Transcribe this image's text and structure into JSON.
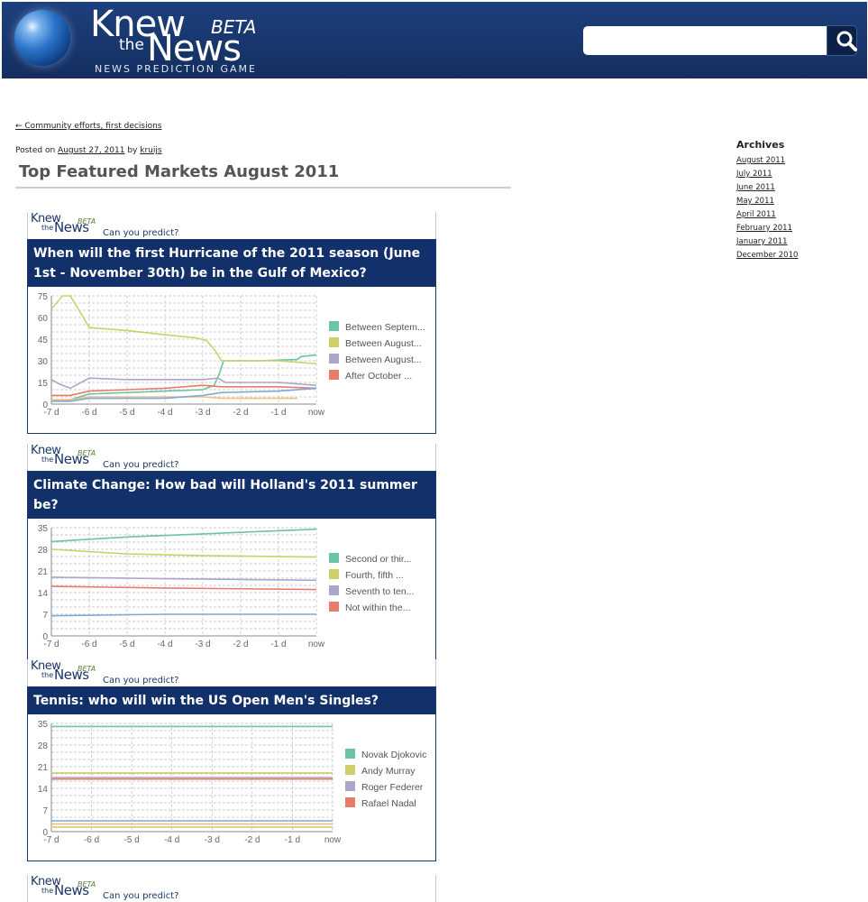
{
  "site": {
    "logo_knew": "Knew",
    "logo_the": "the",
    "logo_news": "News",
    "logo_beta": "BETA",
    "tagline": "NEWS PREDICTION GAME"
  },
  "search": {
    "placeholder": ""
  },
  "post": {
    "prev_link": "← Community efforts, first decisions",
    "posted_on_label": "Posted on",
    "date": "August 27, 2011",
    "by_label": "by",
    "author": "kruijs",
    "title": "Top Featured Markets August 2011"
  },
  "sidebar": {
    "archives_heading": "Archives",
    "archives": [
      "August 2011",
      "July 2011",
      "June 2011",
      "May 2011",
      "April 2011",
      "February 2011",
      "January 2011",
      "December 2010"
    ]
  },
  "widget_brand": {
    "knew": "Knew",
    "the": "the",
    "news": "News",
    "beta": "BETA",
    "can_you_predict": "Can you predict?"
  },
  "widgets": [
    {
      "question": "When will the first Hurricane of the 2011 season (June 1st - November 30th) be in the Gulf of Mexico?"
    },
    {
      "question": "Climate Change: How bad will Holland's 2011 summer be?"
    },
    {
      "question": "Tennis: who will win the US Open Men's Singles?"
    }
  ],
  "chart_data": [
    {
      "type": "line",
      "x_ticks": [
        "-7 d",
        "-6 d",
        "-5 d",
        "-4 d",
        "-3 d",
        "-2 d",
        "-1 d",
        "now"
      ],
      "y_ticks": [
        0,
        15,
        30,
        45,
        60,
        75
      ],
      "ylim": [
        0,
        75
      ],
      "xlim": [
        -7,
        0
      ],
      "grid": true,
      "legend_position": "right",
      "series": [
        {
          "name": "Between Septem...",
          "color": "#6cc4a4",
          "points": [
            [
              -7,
              3
            ],
            [
              -6.5,
              3
            ],
            [
              -6,
              7
            ],
            [
              -5,
              8
            ],
            [
              -4,
              9
            ],
            [
              -3,
              10
            ],
            [
              -2.7,
              13
            ],
            [
              -2.55,
              22
            ],
            [
              -2.45,
              30
            ],
            [
              -1.5,
              30
            ],
            [
              -0.5,
              31
            ],
            [
              -0.4,
              33
            ],
            [
              0,
              34
            ]
          ]
        },
        {
          "name": "Between August...",
          "color": "#cfcf6a",
          "points": [
            [
              -7,
              66
            ],
            [
              -6.7,
              75
            ],
            [
              -6.5,
              75
            ],
            [
              -6.2,
              62
            ],
            [
              -6,
              53
            ],
            [
              -5,
              51
            ],
            [
              -4,
              48
            ],
            [
              -3.2,
              46
            ],
            [
              -2.9,
              44
            ],
            [
              -2.7,
              38
            ],
            [
              -2.55,
              32
            ],
            [
              -2.5,
              30
            ],
            [
              -1,
              30
            ],
            [
              0,
              28
            ]
          ]
        },
        {
          "name": "Between August...",
          "color": "#aaa6cc",
          "points": [
            [
              -7,
              17
            ],
            [
              -6.8,
              14
            ],
            [
              -6.5,
              11
            ],
            [
              -6,
              18
            ],
            [
              -5,
              17
            ],
            [
              -4,
              17
            ],
            [
              -3,
              17
            ],
            [
              -2.6,
              18
            ],
            [
              -2.4,
              15
            ],
            [
              -1,
              15
            ],
            [
              0,
              13
            ]
          ]
        },
        {
          "name": "After October ...",
          "color": "#e87b6a",
          "points": [
            [
              -7,
              6
            ],
            [
              -6.5,
              6
            ],
            [
              -6,
              9
            ],
            [
              -5,
              10
            ],
            [
              -4,
              11
            ],
            [
              -3,
              13
            ],
            [
              -2.5,
              12
            ],
            [
              -1,
              12
            ],
            [
              0,
              11
            ]
          ]
        },
        {
          "name": "",
          "color": "#f0c080",
          "points": [
            [
              -7,
              3
            ],
            [
              -6.5,
              3
            ],
            [
              -6,
              5
            ],
            [
              -5,
              5
            ],
            [
              -3,
              5
            ],
            [
              -2.5,
              4
            ],
            [
              -0.5,
              4
            ]
          ]
        },
        {
          "name": "",
          "color": "#7da8d8",
          "points": [
            [
              -7,
              2
            ],
            [
              -6.5,
              2
            ],
            [
              -6,
              4
            ],
            [
              -4,
              4
            ],
            [
              -3,
              6
            ],
            [
              -2.5,
              8
            ],
            [
              -1,
              9
            ],
            [
              0,
              11
            ]
          ]
        }
      ]
    },
    {
      "type": "line",
      "x_ticks": [
        "-7 d",
        "-6 d",
        "-5 d",
        "-4 d",
        "-3 d",
        "-2 d",
        "-1 d",
        "now"
      ],
      "y_ticks": [
        0,
        7,
        14,
        21,
        28,
        35
      ],
      "ylim": [
        0,
        35
      ],
      "xlim": [
        -7,
        0
      ],
      "grid": true,
      "legend_position": "right",
      "series": [
        {
          "name": "Second or thir...",
          "color": "#6cc4a4",
          "points": [
            [
              -7,
              30.5
            ],
            [
              -5,
              32
            ],
            [
              -3,
              33
            ],
            [
              0,
              34.5
            ]
          ]
        },
        {
          "name": "Fourth, fifth ...",
          "color": "#cfcf6a",
          "points": [
            [
              -7,
              28
            ],
            [
              -5,
              26.5
            ],
            [
              -3,
              26
            ],
            [
              0,
              25.5
            ]
          ]
        },
        {
          "name": "Seventh to ten...",
          "color": "#aaa6cc",
          "points": [
            [
              -7,
              19
            ],
            [
              -4,
              18.5
            ],
            [
              0,
              18
            ]
          ]
        },
        {
          "name": "Not within the...",
          "color": "#e87b6a",
          "points": [
            [
              -7,
              16
            ],
            [
              -4,
              15.5
            ],
            [
              0,
              15
            ]
          ]
        },
        {
          "name": "",
          "color": "#7da8d8",
          "points": [
            [
              -7,
              6.5
            ],
            [
              -4,
              7
            ],
            [
              0,
              7
            ]
          ]
        }
      ]
    },
    {
      "type": "line",
      "x_ticks": [
        "-7 d",
        "-6 d",
        "-5 d",
        "-4 d",
        "-3 d",
        "-2 d",
        "-1 d",
        "now"
      ],
      "y_ticks": [
        0,
        7,
        14,
        21,
        28,
        35
      ],
      "ylim": [
        0,
        35
      ],
      "xlim": [
        -7,
        0
      ],
      "grid": true,
      "legend_position": "right",
      "series": [
        {
          "name": "Novak Djokovic",
          "color": "#6cc4a4",
          "points": [
            [
              -7,
              34
            ],
            [
              0,
              34
            ]
          ]
        },
        {
          "name": "Andy Murray",
          "color": "#cfcf6a",
          "points": [
            [
              -7,
              19
            ],
            [
              0,
              19
            ]
          ]
        },
        {
          "name": "Roger Federer",
          "color": "#aaa6cc",
          "points": [
            [
              -7,
              17.5
            ],
            [
              0,
              17.5
            ]
          ]
        },
        {
          "name": "Rafael Nadal",
          "color": "#e87b6a",
          "points": [
            [
              -7,
              17
            ],
            [
              0,
              17
            ]
          ]
        },
        {
          "name": "",
          "color": "#7da8d8",
          "points": [
            [
              -7,
              3.5
            ],
            [
              0,
              3.5
            ]
          ]
        },
        {
          "name": "",
          "color": "#f0c080",
          "points": [
            [
              -7,
              2.5
            ],
            [
              0,
              2.5
            ]
          ]
        },
        {
          "name": "",
          "color": "#cfcf6a",
          "points": [
            [
              -7,
              1.5
            ],
            [
              0,
              1.5
            ]
          ]
        }
      ]
    }
  ]
}
